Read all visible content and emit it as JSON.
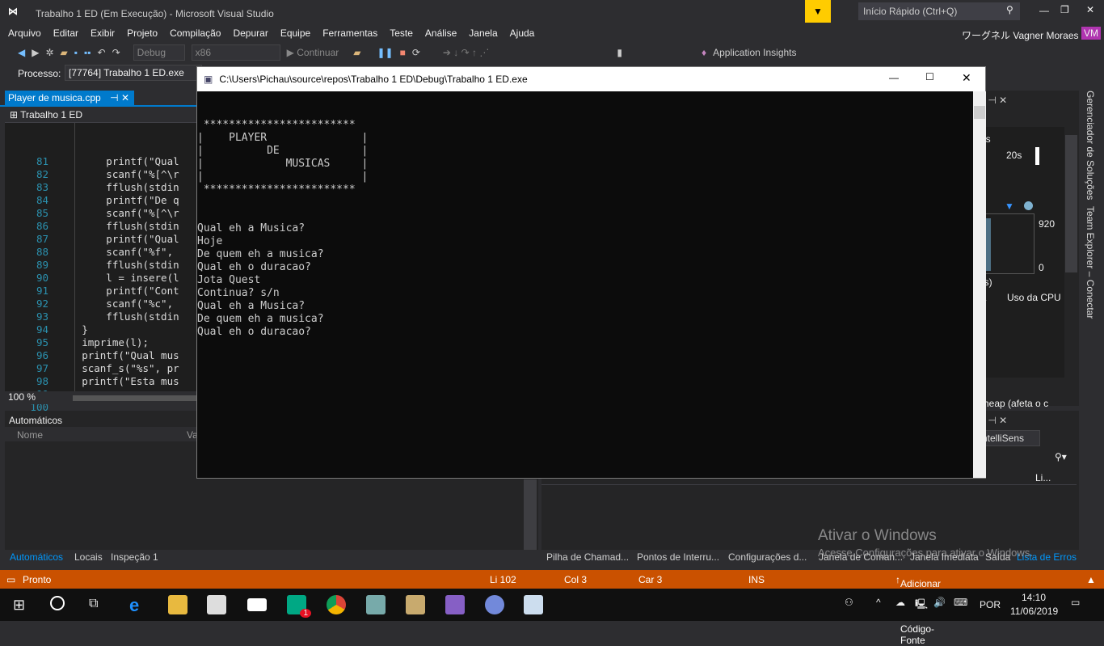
{
  "window": {
    "title": "Trabalho 1 ED (Em Execução) - Microsoft Visual Studio",
    "quick_launch": "Início Rápido (Ctrl+Q)",
    "user": "ワーグネル Vagner Moraes",
    "avatar": "VM"
  },
  "menu": [
    "Arquivo",
    "Editar",
    "Exibir",
    "Projeto",
    "Compilação",
    "Depurar",
    "Equipe",
    "Ferramentas",
    "Teste",
    "Análise",
    "Janela",
    "Ajuda"
  ],
  "toolbar": {
    "config": "Debug",
    "platform": "x86",
    "continue": "Continuar",
    "app_insights": "Application Insights"
  },
  "process": {
    "label": "Processo:",
    "value": "[77764] Trabalho 1 ED.exe"
  },
  "editor": {
    "tab": "Player de musica.cpp",
    "project": "Trabalho 1 ED",
    "zoom": "100 %",
    "line_numbers": [
      "81",
      "82",
      "83",
      "84",
      "85",
      "86",
      "87",
      "88",
      "89",
      "90",
      "91",
      "92",
      "93",
      "94",
      "95",
      "96",
      "97",
      "98",
      "99",
      "100"
    ],
    "lines": [
      "            printf(\"Qual",
      "            scanf(\"%[^\\r",
      "            fflush(stdin",
      "            printf(\"De q",
      "            scanf(\"%[^\\r",
      "            fflush(stdin",
      "            printf(\"Qual",
      "            scanf(\"%f\",",
      "            fflush(stdin",
      "            l = insere(l",
      "            printf(\"Cont",
      "            scanf(\"%c\",",
      "            fflush(stdin",
      "",
      "        }",
      "",
      "        imprime(l);",
      "        printf(\"Qual mus",
      "        scanf_s(\"%s\", pr",
      "        printf(\"Esta mus"
    ]
  },
  "autos": {
    "title": "Automáticos",
    "col_name": "Nome",
    "col_value": "Va",
    "tabs": [
      "Automáticos",
      "Locais",
      "Inspeção 1"
    ]
  },
  "console": {
    "title": "C:\\Users\\Pichau\\source\\repos\\Trabalho 1 ED\\Debug\\Trabalho 1 ED.exe",
    "lines": [
      " ************************",
      "|    PLAYER               |",
      "|          DE             |",
      "|             MUSICAS     |",
      "|                         |",
      " ************************",
      "",
      "",
      "Qual eh a Musica?",
      "Hoje",
      "De quem eh a musica?",
      "Qual eh o duracao?",
      "Jota Quest",
      "Continua? s/n",
      "Qual eh a Musica?",
      "De quem eh a musica?",
      "Qual eh o duracao?"
    ]
  },
  "diagnostics": {
    "events_fragment": "os",
    "time": "20s",
    "max": "920",
    "min": "0",
    "fragment": "res)",
    "tabs": [
      "ria",
      "Uso da CPU"
    ],
    "heap": "e heap (afeta o c"
  },
  "errors": {
    "filter": "ntelliSens",
    "col": "Li...",
    "tabs": [
      "Pilha de Chamad...",
      "Pontos de Interru...",
      "Configurações d...",
      "Janela de Coman...",
      "Janela Imediata",
      "Saída",
      "Lista de Erros"
    ]
  },
  "side_tabs": [
    "Gerenciador de Soluções",
    "Team Explorer – Conectar"
  ],
  "watermark": {
    "title": "Ativar o Windows",
    "subtitle": "Acesse Configurações para ativar o Windows."
  },
  "status": {
    "state": "Pronto",
    "line": "Li 102",
    "col": "Col 3",
    "char": "Car 3",
    "mode": "INS",
    "source_control": "Adicionar ao Controle do Código-Fonte"
  },
  "taskbar": {
    "lang": "POR",
    "time": "14:10",
    "date": "11/06/2019",
    "badge": "1"
  },
  "colors": {
    "accent": "#007acc",
    "status": "#ca5100",
    "bg": "#2d2d30"
  }
}
